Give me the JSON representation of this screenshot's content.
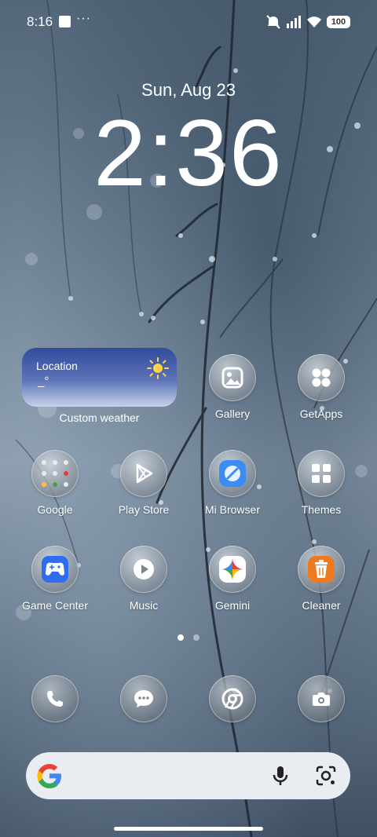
{
  "status_bar": {
    "time": "8:16",
    "overflow": "···",
    "battery": "100"
  },
  "lockclock": {
    "date": "Sun, Aug 23",
    "time": "2:36"
  },
  "weather_widget": {
    "location": "Location",
    "temperature": "_°",
    "label": "Custom weather",
    "gradient_top": "#324a9c",
    "gradient_bottom": "#c7d1ea"
  },
  "apps": {
    "gallery": "Gallery",
    "getapps": "GetApps",
    "google": "Google",
    "play_store": "Play Store",
    "mi_browser": "Mi Browser",
    "themes": "Themes",
    "game_center": "Game Center",
    "music": "Music",
    "gemini": "Gemini",
    "cleaner": "Cleaner"
  },
  "page_indicator": {
    "pages": 2,
    "active": 1
  },
  "dock": {
    "items": [
      "phone-icon",
      "messages-icon",
      "chrome-icon",
      "camera-icon"
    ]
  },
  "search_bar": {
    "icons": [
      "google-g-icon",
      "microphone-icon",
      "google-lens-icon"
    ]
  },
  "colors": {
    "cleaner": "#f07a22",
    "game_center": "#2f6cf0",
    "browser": "#3b8cf5",
    "play": "#ffffff"
  }
}
